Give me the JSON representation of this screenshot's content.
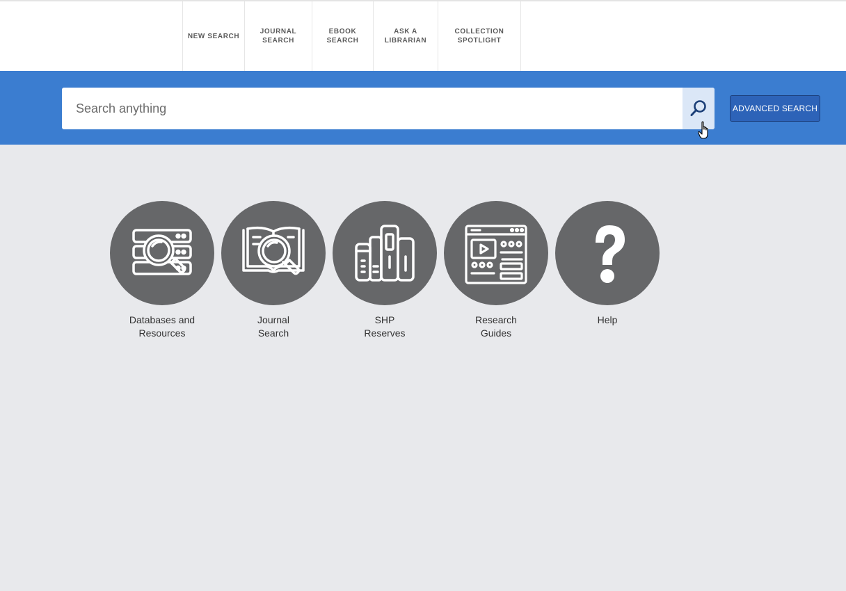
{
  "nav": {
    "items": [
      {
        "label": "NEW SEARCH"
      },
      {
        "label": "JOURNAL\nSEARCH"
      },
      {
        "label": "EBOOK\nSEARCH"
      },
      {
        "label": "ASK A\nLIBRARIAN"
      },
      {
        "label": "COLLECTION\nSPOTLIGHT"
      }
    ]
  },
  "search": {
    "placeholder": "Search anything",
    "value": "",
    "button_icon": "search-icon",
    "advanced_label": "ADVANCED SEARCH"
  },
  "tiles": [
    {
      "label": "Databases and\nResources",
      "icon": "database-search-icon"
    },
    {
      "label": "Journal\nSearch",
      "icon": "journal-search-icon"
    },
    {
      "label": "SHP\nReserves",
      "icon": "books-icon"
    },
    {
      "label": "Research\nGuides",
      "icon": "web-guide-icon"
    },
    {
      "label": "Help",
      "icon": "question-mark-icon"
    }
  ],
  "colors": {
    "band": "#3b7dd0",
    "tile_circle": "#666769",
    "advanced_button": "#2d63b8",
    "background": "#e8e9ec"
  }
}
